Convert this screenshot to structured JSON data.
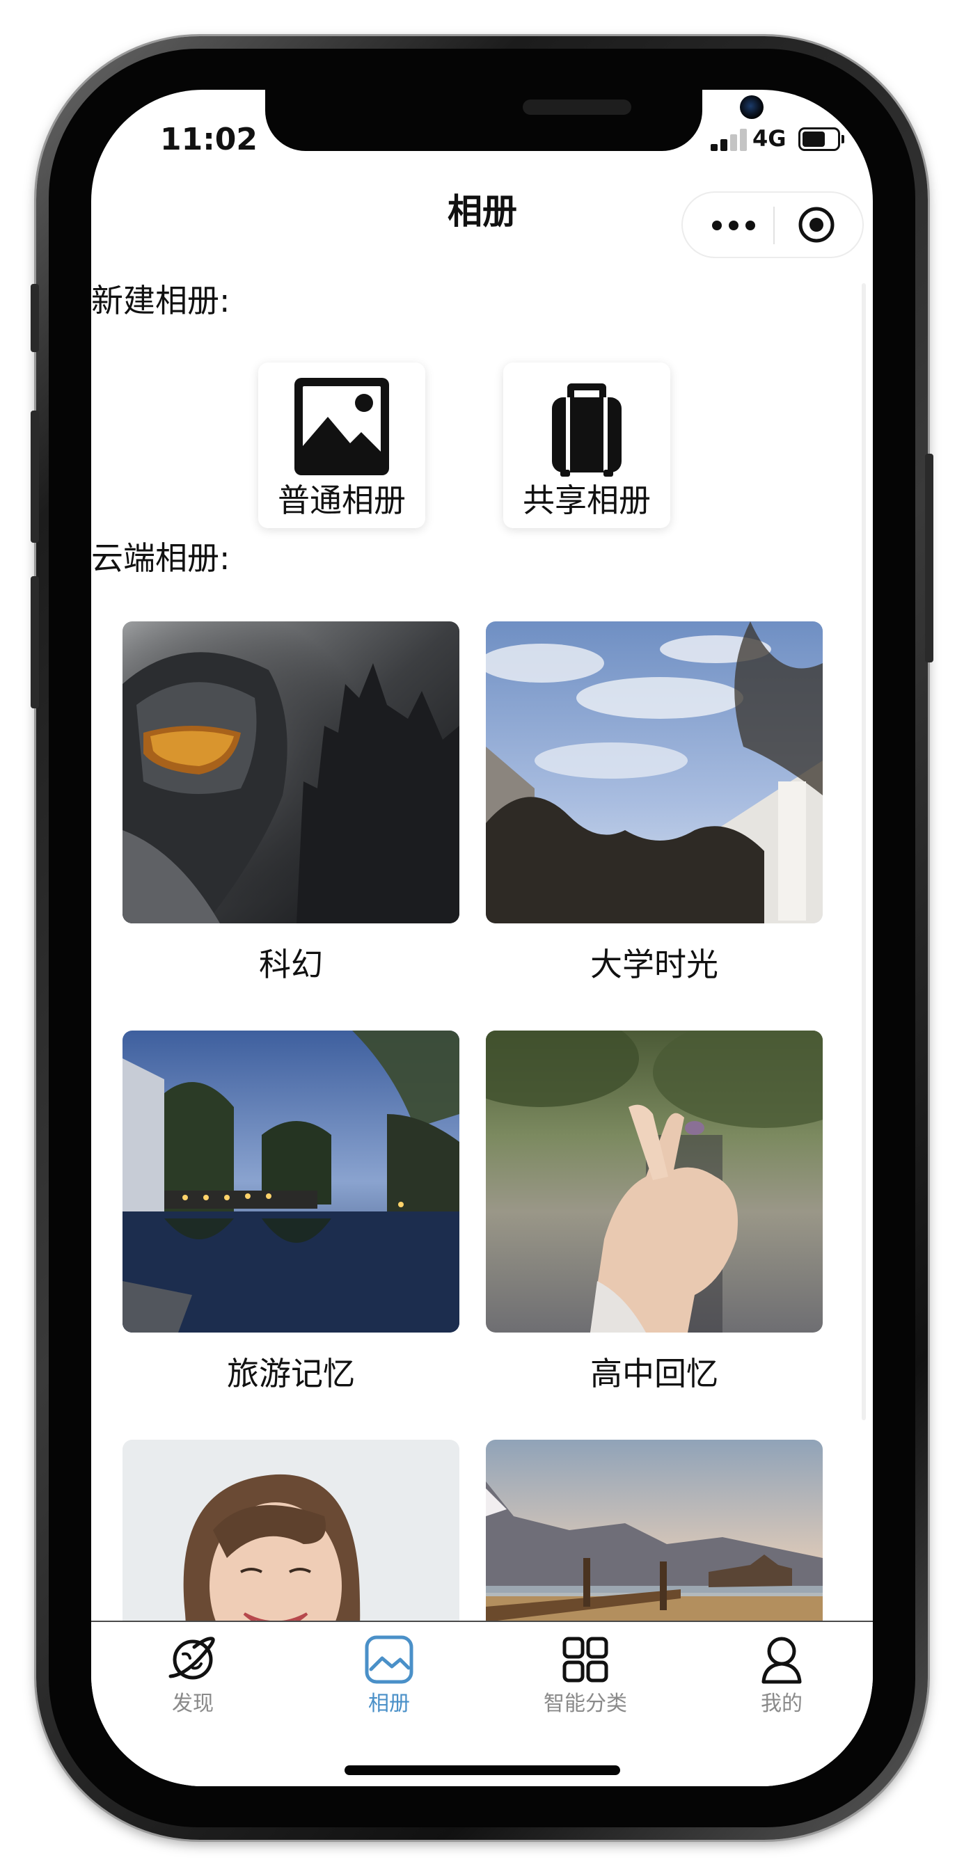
{
  "status_bar": {
    "time": "11:02",
    "network": "4G",
    "signal_bars": 2,
    "battery_level": 0.6
  },
  "nav": {
    "title": "相册",
    "more_icon": "ellipsis-icon",
    "close_icon": "target-icon"
  },
  "new_album": {
    "section_label": "新建相册:",
    "options": [
      {
        "label": "普通相册",
        "icon": "image-icon"
      },
      {
        "label": "共享相册",
        "icon": "suitcase-icon"
      }
    ]
  },
  "cloud_albums": {
    "section_label": "云端相册:",
    "albums": [
      {
        "title": "科幻",
        "image": "sci-fi-helmet-photo"
      },
      {
        "title": "大学时光",
        "image": "campus-sky-photo"
      },
      {
        "title": "旅游记忆",
        "image": "canal-dusk-photo"
      },
      {
        "title": "高中回忆",
        "image": "finger-heart-photo"
      },
      {
        "title": "",
        "image": "smiling-girl-photo"
      },
      {
        "title": "",
        "image": "mountain-farm-photo"
      }
    ]
  },
  "tab_bar": {
    "active_index": 1,
    "accent_color": "#4a90c8",
    "inactive_color": "#8a8a8a",
    "tabs": [
      {
        "label": "发现",
        "icon": "planet-icon"
      },
      {
        "label": "相册",
        "icon": "gallery-icon"
      },
      {
        "label": "智能分类",
        "icon": "grid-icon"
      },
      {
        "label": "我的",
        "icon": "user-icon"
      }
    ]
  }
}
